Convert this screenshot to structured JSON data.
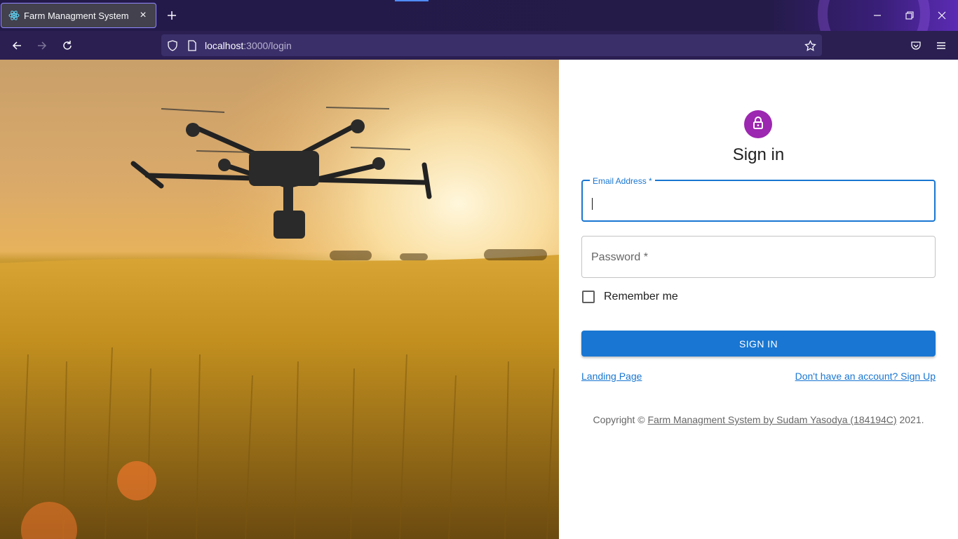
{
  "browser": {
    "tab_title": "Farm Managment System",
    "url_host": "localhost",
    "url_rest": ":3000/login",
    "favicon": "react-icon",
    "colors": {
      "tabbar": "#241a4a",
      "accent": "#8f87ff"
    }
  },
  "login": {
    "heading": "Sign in",
    "email_label": "Email Address *",
    "password_placeholder": "Password *",
    "remember_label": "Remember me",
    "signin_button": "SIGN IN",
    "landing_link": "Landing Page",
    "signup_link": "Don't have an account? Sign Up",
    "copyright_prefix": "Copyright © ",
    "copyright_link": "Farm Managment System by Sudam Yasodya (184194C)",
    "copyright_suffix": " 2021.",
    "colors": {
      "primary": "#1976d2",
      "avatar": "#9c27b0"
    }
  }
}
